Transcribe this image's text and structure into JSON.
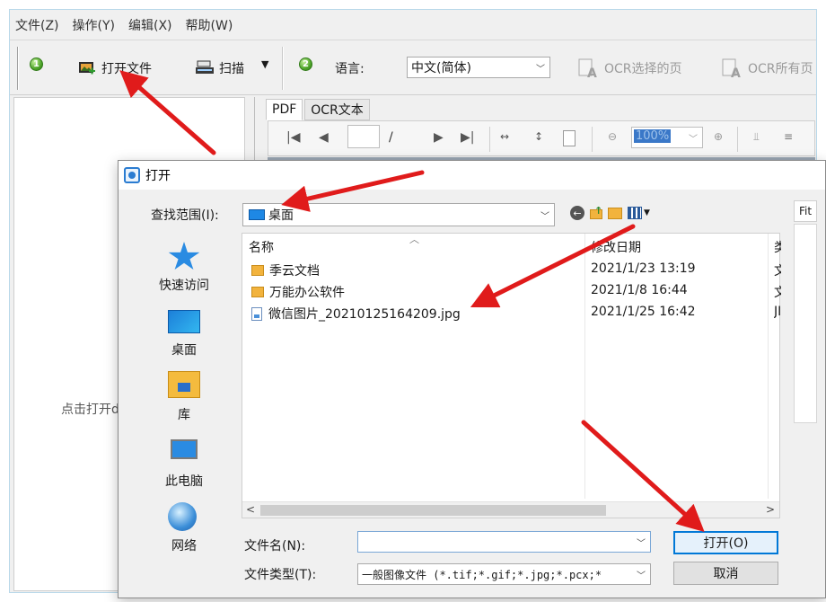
{
  "menu": {
    "items": [
      "文件(Z)",
      "操作(Y)",
      "编辑(X)",
      "帮助(W)"
    ]
  },
  "toolbar": {
    "step1_badge": "1",
    "open_file": "打开文件",
    "scan": "扫描",
    "step2_badge": "2",
    "language_label": "语言:",
    "language_value": "中文(简体)",
    "ocr_selected": "OCR选择的页",
    "ocr_all": "OCR所有页"
  },
  "left_panel": {
    "hint": "点击打开d"
  },
  "viewer": {
    "tabs": [
      "PDF",
      "OCR文本"
    ],
    "page_separator": "/",
    "zoom": "100%"
  },
  "dialog": {
    "title": "打开",
    "look_in_label": "查找范围(I):",
    "look_in_value": "桌面",
    "fit": "Fit",
    "places": [
      "快速访问",
      "桌面",
      "库",
      "此电脑",
      "网络"
    ],
    "columns": {
      "name": "名称",
      "date": "修改日期",
      "type": "类"
    },
    "files": [
      {
        "name": "季云文档",
        "date": "2021/1/23 13:19",
        "type": "文",
        "kind": "folder"
      },
      {
        "name": "万能办公软件",
        "date": "2021/1/8 16:44",
        "type": "文",
        "kind": "folder"
      },
      {
        "name": "微信图片_20210125164209.jpg",
        "date": "2021/1/25 16:42",
        "type": "JI",
        "kind": "image"
      }
    ],
    "file_name_label": "文件名(N):",
    "file_name_value": "",
    "file_type_label": "文件类型(T):",
    "file_type_value": "一般图像文件 (*.tif;*.gif;*.jpg;*.pcx;*",
    "open_button": "打开(O)",
    "cancel_button": "取消"
  },
  "colors": {
    "annotation_arrow": "#e01b1b",
    "accent": "#0078d7"
  }
}
